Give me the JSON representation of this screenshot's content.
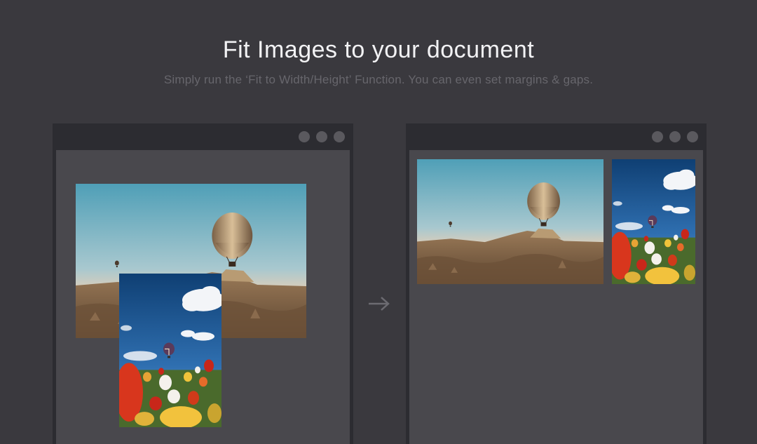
{
  "hero": {
    "title": "Fit Images to your document",
    "subtitle": "Simply run the ‘Fit to Width/Height’ Function. You can even set margins & gaps."
  },
  "windows": {
    "before": {
      "controls": [
        "dot",
        "dot",
        "dot"
      ]
    },
    "after": {
      "controls": [
        "dot",
        "dot",
        "dot"
      ]
    }
  },
  "icons": {
    "arrow": "arrow-right-icon",
    "window_control": "window-control-dot-icon"
  },
  "images": [
    {
      "name": "landscape-balloon-photo",
      "subject": "hot air balloons over rocky valley"
    },
    {
      "name": "portrait-tulip-photo",
      "subject": "tulip field with hot air balloon and clouds"
    }
  ],
  "colors": {
    "background": "#3a393e",
    "window_frame": "#2c2c31",
    "canvas": "#49484d",
    "title_text": "#f2f2f4",
    "subtitle_text": "#67666c"
  }
}
